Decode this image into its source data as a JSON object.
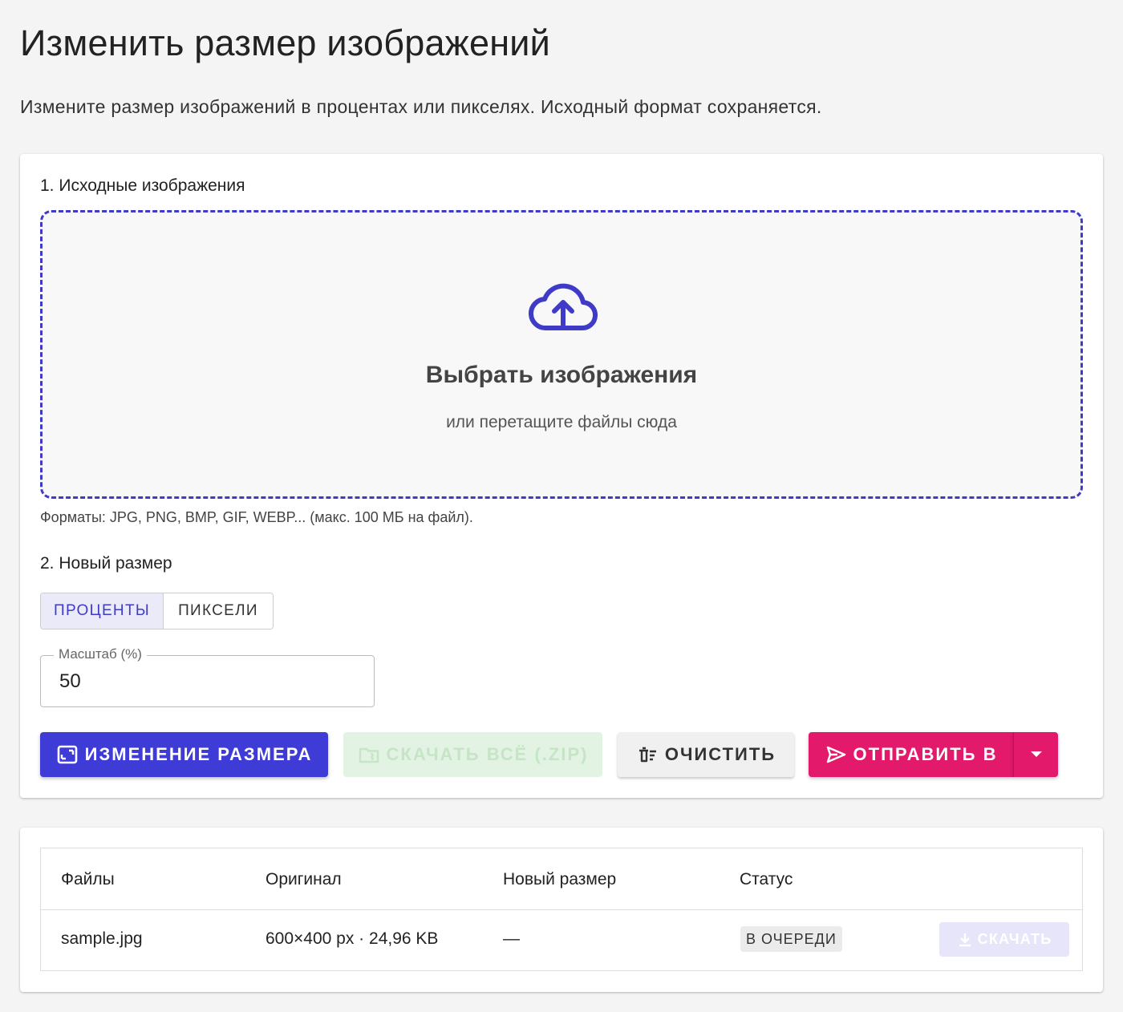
{
  "page": {
    "title": "Изменить размер изображений",
    "subtitle": "Измените размер изображений в процентах или пикселях. Исходный формат сохраняется."
  },
  "source": {
    "section_title": "1. Исходные изображения",
    "dropzone_title": "Выбрать изображения",
    "dropzone_hint": "или перетащите файлы сюда",
    "formats_note": "Форматы: JPG, PNG, BMP, GIF, WEBP... (макс. 100 МБ на файл).",
    "icon": "cloud-upload-icon"
  },
  "size": {
    "section_title": "2. Новый размер",
    "mode_options": [
      "ПРОЦЕНТЫ",
      "ПИКСЕЛИ"
    ],
    "selected_mode": "ПРОЦЕНТЫ",
    "scale_label": "Масштаб (%)",
    "scale_value": "50"
  },
  "actions": {
    "resize_label": "ИЗМЕНЕНИЕ РАЗМЕРА",
    "zip_label": "СКАЧАТЬ ВСЁ (.ZIP)",
    "clear_label": "ОЧИСТИТЬ",
    "send_label": "ОТПРАВИТЬ В"
  },
  "files": {
    "columns": [
      "Файлы",
      "Оригинал",
      "Новый размер",
      "Статус"
    ],
    "rows": [
      {
        "name": "sample.jpg",
        "original": "600×400 px · 24,96 KB",
        "new_size": "—",
        "status": "В ОЧЕРЕДИ",
        "download_label": "СКАЧАТЬ"
      }
    ]
  },
  "colors": {
    "accent": "#3f3bd6",
    "send": "#e3196b",
    "dropzone_border": "#3f3bc8",
    "background": "#f4f4f4"
  }
}
